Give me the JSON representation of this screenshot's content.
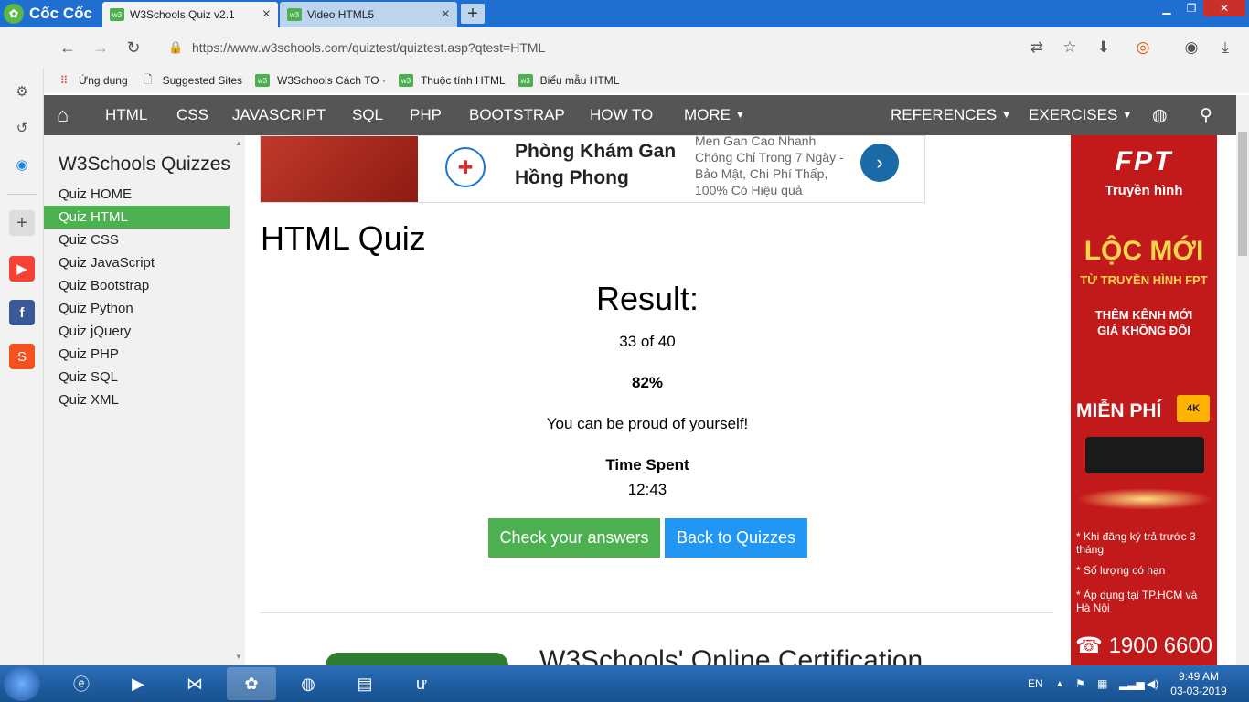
{
  "browser": {
    "brand": "Cốc Cốc",
    "tabs": [
      {
        "label": "W3Schools Quiz v2.1",
        "active": true
      },
      {
        "label": "Video HTML5",
        "active": false
      }
    ],
    "url": "https://www.w3schools.com/quiztest/quiztest.asp?qtest=HTML",
    "bookmarks": [
      {
        "label": "Ứng dụng",
        "icon": "apps-grid-icon"
      },
      {
        "label": "Suggested Sites",
        "icon": "page-icon"
      },
      {
        "label": "W3Schools Cách TO ·",
        "icon": "w3-icon"
      },
      {
        "label": "Thuộc tính HTML",
        "icon": "w3-icon"
      },
      {
        "label": "Biểu mẫu HTML",
        "icon": "w3-icon"
      }
    ]
  },
  "w3nav": {
    "items": [
      "HTML",
      "CSS",
      "JAVASCRIPT",
      "SQL",
      "PHP",
      "BOOTSTRAP",
      "HOW TO",
      "MORE"
    ],
    "references": "REFERENCES",
    "exercises": "EXERCISES"
  },
  "quizmenu": {
    "title": "W3Schools Quizzes",
    "items": [
      "Quiz HOME",
      "Quiz HTML",
      "Quiz CSS",
      "Quiz JavaScript",
      "Quiz Bootstrap",
      "Quiz Python",
      "Quiz jQuery",
      "Quiz PHP",
      "Quiz SQL",
      "Quiz XML"
    ],
    "active_index": 1
  },
  "ad": {
    "title": "Phòng Khám Gan Hồng Phong",
    "description": "Men Gan Cao Nhanh Chóng Chỉ Trong 7 Ngày - Bảo Mật, Chi Phí Thấp, 100% Có Hiệu quả"
  },
  "main": {
    "title": "HTML Quiz",
    "result_heading": "Result:",
    "score": "33 of 40",
    "percent": "82%",
    "praise": "You can be proud of yourself!",
    "time_label": "Time Spent",
    "time_value": "12:43",
    "check_button": "Check your answers",
    "back_button": "Back to Quizzes",
    "cert_title": "W3Schools' Online Certification"
  },
  "fpt_ad": {
    "logo": "FPT",
    "subtitle": "Truyền hình",
    "headline": "LỘC MỚI",
    "line1": "TỪ TRUYỀN HÌNH FPT",
    "line2": "THÊM KÊNH MỚI",
    "line3": "GIÁ KHÔNG ĐỔI",
    "free": "MIỄN PHÍ",
    "badge": "4K",
    "bullets": [
      "* Khi đăng ký trả trước 3 tháng",
      "* Số lượng có hạn",
      "* Áp dụng tại TP.HCM và Hà Nội"
    ],
    "phone": "1900 6600"
  },
  "taskbar": {
    "language": "EN",
    "time": "9:49 AM",
    "date": "03-03-2019"
  },
  "colors": {
    "accent_green": "#4caf50",
    "accent_blue": "#2196f3",
    "nav_gray": "#555555",
    "tabbar_blue": "#1e6fd0"
  }
}
